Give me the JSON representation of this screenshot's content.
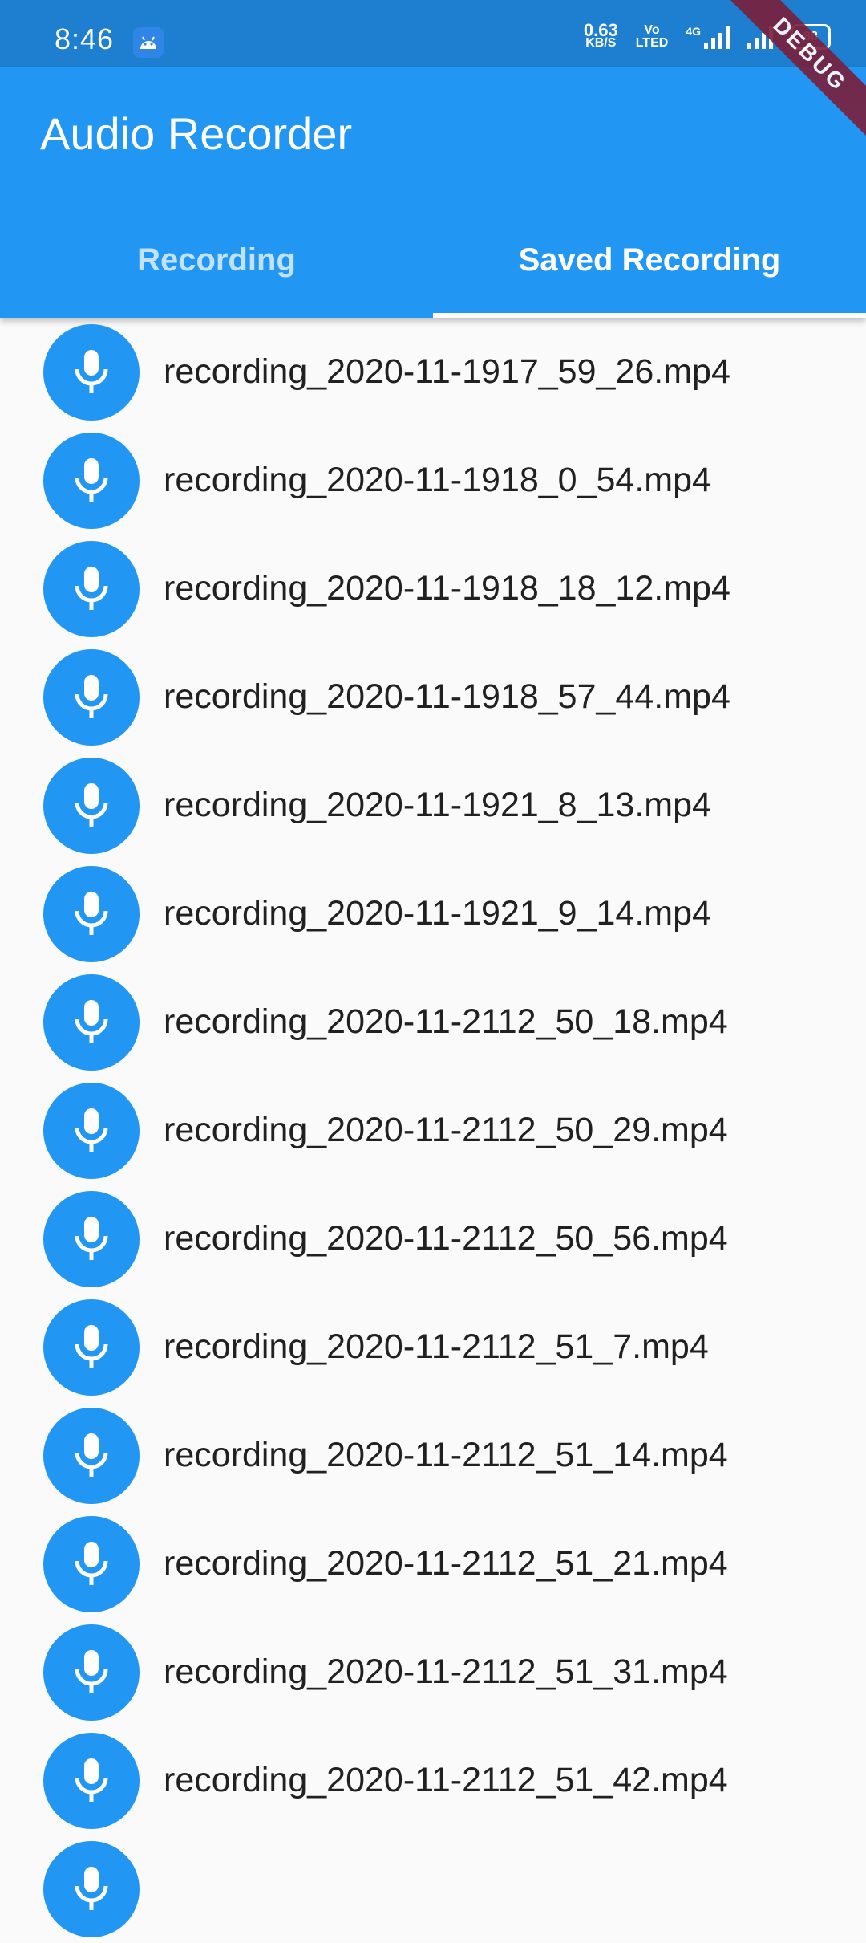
{
  "status_bar": {
    "time": "8:46",
    "net_speed_value": "0.63",
    "net_speed_unit": "KB/S",
    "volte_top": "Vo",
    "volte_bottom": "LTED",
    "network_type": "4G",
    "battery": "88"
  },
  "debug_banner": "DEBUG",
  "app_bar": {
    "title": "Audio Recorder",
    "background": "#2196f3"
  },
  "tabs": [
    {
      "label": "Recording",
      "selected": false
    },
    {
      "label": "Saved Recording",
      "selected": true
    }
  ],
  "recordings": [
    {
      "name": "recording_2020-11-1917_59_26.mp4",
      "icon": "mic-icon"
    },
    {
      "name": "recording_2020-11-1918_0_54.mp4",
      "icon": "mic-icon"
    },
    {
      "name": "recording_2020-11-1918_18_12.mp4",
      "icon": "mic-icon"
    },
    {
      "name": "recording_2020-11-1918_57_44.mp4",
      "icon": "mic-icon"
    },
    {
      "name": "recording_2020-11-1921_8_13.mp4",
      "icon": "mic-icon"
    },
    {
      "name": "recording_2020-11-1921_9_14.mp4",
      "icon": "mic-icon"
    },
    {
      "name": "recording_2020-11-2112_50_18.mp4",
      "icon": "mic-icon"
    },
    {
      "name": "recording_2020-11-2112_50_29.mp4",
      "icon": "mic-icon"
    },
    {
      "name": "recording_2020-11-2112_50_56.mp4",
      "icon": "mic-icon"
    },
    {
      "name": "recording_2020-11-2112_51_7.mp4",
      "icon": "mic-icon"
    },
    {
      "name": "recording_2020-11-2112_51_14.mp4",
      "icon": "mic-icon"
    },
    {
      "name": "recording_2020-11-2112_51_21.mp4",
      "icon": "mic-icon"
    },
    {
      "name": "recording_2020-11-2112_51_31.mp4",
      "icon": "mic-icon"
    },
    {
      "name": "recording_2020-11-2112_51_42.mp4",
      "icon": "mic-icon"
    }
  ]
}
